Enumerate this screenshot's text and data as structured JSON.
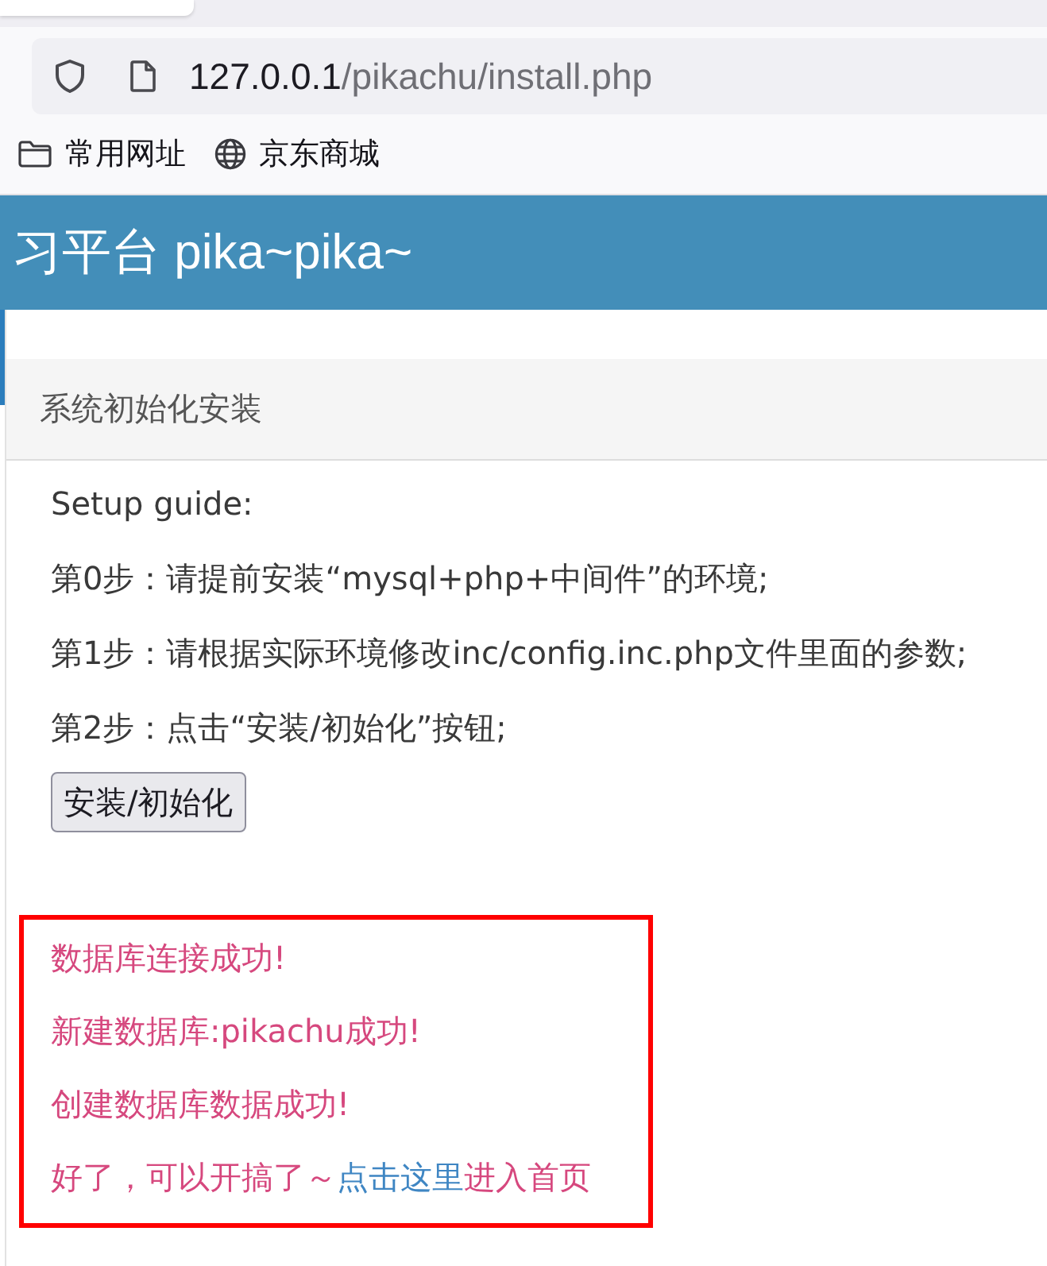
{
  "browser": {
    "address_bar": {
      "host": "127.0.0.1",
      "path": "/pikachu/install.php"
    },
    "bookmarks": [
      {
        "kind": "folder",
        "label": "常用网址"
      },
      {
        "kind": "site",
        "label": "京东商城"
      }
    ]
  },
  "header": {
    "title": "习平台 pika~pika~"
  },
  "panel": {
    "title": "系统初始化安装",
    "guide": [
      "Setup guide:",
      "第0步：请提前安装“mysql+php+中间件”的环境;",
      "第1步：请根据实际环境修改inc/config.inc.php文件里面的参数;",
      "第2步：点击“安装/初始化”按钮;"
    ],
    "button": "安装/初始化"
  },
  "messages": [
    "数据库连接成功!",
    "新建数据库:pikachu成功!",
    "创建数据库数据成功!"
  ],
  "finish": {
    "text": "好了，可以开搞了～",
    "link": "点击这里",
    "after": "进入首页"
  }
}
